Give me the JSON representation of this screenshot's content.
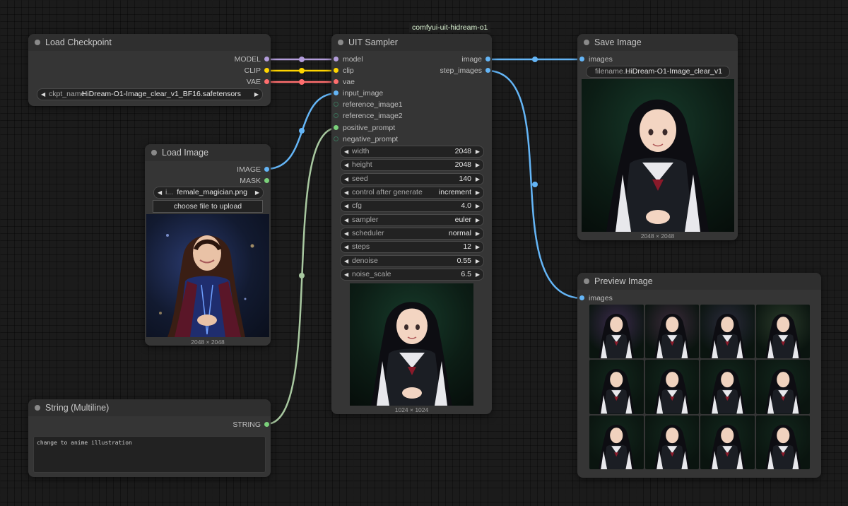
{
  "workflow_badge": "comfyui-uit-hidream-o1",
  "colors": {
    "model_link": "#b39ddb",
    "clip_link": "#ffd500",
    "vae_link": "#ff6e6e",
    "image_link": "#64b5f6",
    "string_link": "#a8c8a0",
    "canvas_bg": "#1b1b1b",
    "node_bg": "#353535"
  },
  "nodes": {
    "load_checkpoint": {
      "title": "Load Checkpoint",
      "outputs": [
        "MODEL",
        "CLIP",
        "VAE"
      ],
      "widget": {
        "name": "ckpt_name",
        "value": "HiDream-O1-Image_clear_v1_BF16.safetensors"
      }
    },
    "load_image": {
      "title": "Load Image",
      "outputs": [
        "IMAGE",
        "MASK"
      ],
      "widget": {
        "name": "i...",
        "value": "female_magician.png"
      },
      "upload_label": "choose file to upload",
      "preview_dims": "2048 × 2048"
    },
    "string_multiline": {
      "title": "String (Multiline)",
      "output": "STRING",
      "text": "change to anime illustration"
    },
    "uit_sampler": {
      "title": "UIT Sampler",
      "inputs": [
        "model",
        "clip",
        "vae",
        "input_image",
        "reference_image1",
        "reference_image2",
        "positive_prompt",
        "negative_prompt"
      ],
      "outputs": [
        "image",
        "step_images"
      ],
      "widgets": [
        {
          "name": "width",
          "value": "2048"
        },
        {
          "name": "height",
          "value": "2048"
        },
        {
          "name": "seed",
          "value": "140"
        },
        {
          "name": "control after generate",
          "value": "increment"
        },
        {
          "name": "cfg",
          "value": "4.0"
        },
        {
          "name": "sampler",
          "value": "euler"
        },
        {
          "name": "scheduler",
          "value": "normal"
        },
        {
          "name": "steps",
          "value": "12"
        },
        {
          "name": "denoise",
          "value": "0.55"
        },
        {
          "name": "noise_scale",
          "value": "6.5"
        }
      ],
      "preview_dims": "1024 × 1024"
    },
    "save_image": {
      "title": "Save Image",
      "input": "images",
      "widget": {
        "name": "filename...",
        "value": "HiDream-O1-Image_clear_v1"
      },
      "preview_dims": "2048 × 2048"
    },
    "preview_image": {
      "title": "Preview Image",
      "input": "images"
    }
  },
  "icons": {
    "collapse": "circle-dot-icon",
    "arrow_left": "triangle-left-icon",
    "arrow_right": "triangle-right-icon"
  }
}
